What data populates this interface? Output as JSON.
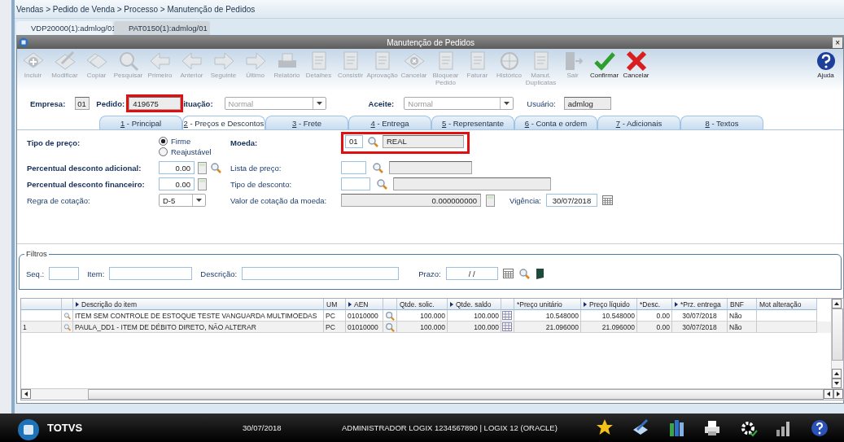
{
  "breadcrumb": "Vendas > Pedido de Venda > Processo > Manutenção de Pedidos",
  "window_tabs": [
    {
      "label": "VDP20000(1):admlog/01",
      "selected": true
    },
    {
      "label": "PAT0150(1):admlog/01",
      "selected": false
    }
  ],
  "window": {
    "title": "Manutenção de Pedidos",
    "close": "×"
  },
  "toolbar": [
    {
      "label": "Incluir",
      "kind": "add",
      "disabled": true
    },
    {
      "label": "Modificar",
      "kind": "edit",
      "disabled": true
    },
    {
      "label": "Copiar",
      "kind": "copy",
      "disabled": true
    },
    {
      "label": "Pesquisar",
      "kind": "search",
      "disabled": true
    },
    {
      "label": "Primeiro",
      "kind": "prev",
      "disabled": true
    },
    {
      "label": "Anterior",
      "kind": "prev",
      "disabled": true
    },
    {
      "label": "Seguinte",
      "kind": "next",
      "disabled": true
    },
    {
      "label": "Último",
      "kind": "next",
      "disabled": true
    },
    {
      "label": "Relatório",
      "kind": "print",
      "disabled": true
    },
    {
      "label": "Detalhes",
      "kind": "doc",
      "disabled": true
    },
    {
      "label": "Consistir",
      "kind": "doc",
      "disabled": true
    },
    {
      "label": "Aprovação",
      "kind": "doc",
      "disabled": true
    },
    {
      "label": "Cancelar",
      "kind": "cancel",
      "disabled": true
    },
    {
      "label": "Bloquear Pedido",
      "kind": "doc",
      "disabled": true
    },
    {
      "label": "Faturar",
      "kind": "doc",
      "disabled": true
    },
    {
      "label": "Histórico",
      "kind": "globe",
      "disabled": true
    },
    {
      "label": "Manut. Duplicatas",
      "kind": "doc",
      "disabled": true
    },
    {
      "label": "Sair",
      "kind": "door",
      "disabled": true
    },
    {
      "label": "Confirmar",
      "kind": "confirm",
      "disabled": false
    },
    {
      "label": "Cancelar",
      "kind": "reject",
      "disabled": false
    },
    {
      "label": "Ajuda",
      "kind": "help",
      "disabled": false
    }
  ],
  "header": {
    "empresa": {
      "label": "Empresa:",
      "value": "01"
    },
    "pedido": {
      "label": "Pedido:",
      "value": "419675",
      "highlighted": true
    },
    "situacao": {
      "label": "ituação:",
      "value": "Normal"
    },
    "aceite": {
      "label": "Aceite:",
      "value": "Normal"
    },
    "usuario": {
      "label": "Usuário:",
      "value": "admlog"
    }
  },
  "form_tabs": [
    {
      "key": "1",
      "label": "- Principal",
      "selected": false
    },
    {
      "key": "2",
      "label": "- Preços e Descontos",
      "selected": true
    },
    {
      "key": "3",
      "label": "- Frete",
      "selected": false
    },
    {
      "key": "4",
      "label": "- Entrega",
      "selected": false
    },
    {
      "key": "5",
      "label": "- Representante",
      "selected": false
    },
    {
      "key": "6",
      "label": "- Conta e ordem",
      "selected": false
    },
    {
      "key": "7",
      "label": "- Adicionais",
      "selected": false
    },
    {
      "key": "8",
      "label": "- Textos",
      "selected": false
    }
  ],
  "prices": {
    "tipo_preco": {
      "label": "Tipo de preço:",
      "options": [
        {
          "label": "Firme",
          "selected": true
        },
        {
          "label": "Reajustável",
          "selected": false
        }
      ]
    },
    "moeda": {
      "label": "Moeda:",
      "code": "01",
      "name": "REAL",
      "highlighted": true
    },
    "desconto_adicional": {
      "label": "Percentual desconto adicional:",
      "value": "0.00"
    },
    "lista_preco": {
      "label": "Lista de preço:"
    },
    "desconto_financeiro": {
      "label": "Percentual desconto financeiro:",
      "value": "0.00"
    },
    "tipo_desconto": {
      "label": "Tipo de desconto:"
    },
    "regra_cotacao": {
      "label": "Regra de cotação:",
      "value": "D-5"
    },
    "valor_cotacao": {
      "label": "Valor de cotação da moeda:",
      "value": "0.000000000"
    },
    "vigencia": {
      "label": "Vigência:",
      "value": "30/07/2018"
    }
  },
  "filters": {
    "title": "Filtros",
    "seq": "Seq.:",
    "item": "Item:",
    "descricao": "Descrição:",
    "prazo": {
      "label": "Prazo:",
      "value": "/ /"
    }
  },
  "grid": {
    "columns": [
      {
        "kind": "marker"
      },
      {
        "kind": "icon"
      },
      {
        "kind": "text",
        "label": "Descrição do item",
        "arrow": true
      },
      {
        "kind": "text",
        "label": "UM",
        "arrow": false
      },
      {
        "kind": "text",
        "label": "AEN",
        "arrow": true
      },
      {
        "kind": "icon"
      },
      {
        "kind": "number",
        "label": "Qtde. solic.",
        "arrow": false
      },
      {
        "kind": "number",
        "label": "Qtde. saldo",
        "arrow": true
      },
      {
        "kind": "table_icon"
      },
      {
        "kind": "number",
        "label": "*Preço unitário",
        "arrow": false
      },
      {
        "kind": "number",
        "label": "Preço líquido",
        "arrow": true
      },
      {
        "kind": "number",
        "label": "*Desc.",
        "arrow": false
      },
      {
        "kind": "center",
        "label": "*Prz. entrega",
        "arrow": true
      },
      {
        "kind": "text",
        "label": "BNF",
        "arrow": false
      },
      {
        "kind": "text",
        "label": "Mot alteração",
        "arrow": false
      }
    ],
    "rows": [
      {
        "selected": false,
        "cells": [
          "",
          "",
          "ITEM SEM CONTROLE DE ESTOQUE TESTE VANGUARDA MULTIMOEDAS",
          "PC",
          "01010000",
          "",
          "100.000",
          "100.000",
          "",
          "10.548000",
          "10.548000",
          "0.00",
          "30/07/2018",
          "Não",
          ""
        ]
      },
      {
        "selected": true,
        "cells": [
          "1",
          "",
          "PAULA_DD1 - ITEM DE DÉBITO DIRETO, NÃO ALTERAR",
          "PC",
          "01010000",
          "",
          "100.000",
          "100.000",
          "",
          "21.096000",
          "21.096000",
          "0.00",
          "30/07/2018",
          "Não",
          ""
        ]
      }
    ]
  },
  "taskbar": {
    "logo": "TOTVS",
    "date": "30/07/2018",
    "session": "ADMINISTRADOR LOGIX 1234567890 | LOGIX 12 (ORACLE)"
  }
}
